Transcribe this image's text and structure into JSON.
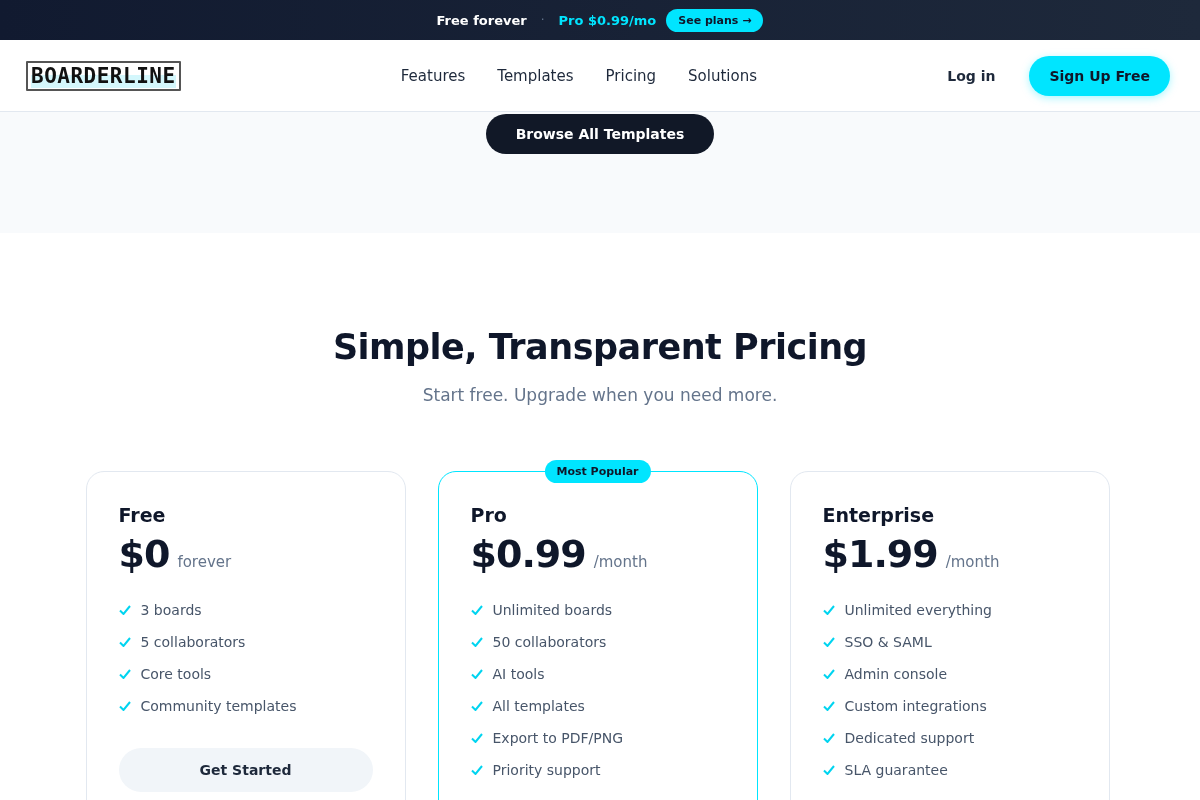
{
  "promo_bar": {
    "text": "Free forever",
    "separator": "·",
    "highlight": "Pro $0.99/mo",
    "button": "See plans →"
  },
  "header": {
    "logo": "BOARDERLINE",
    "nav": [
      {
        "label": "Features"
      },
      {
        "label": "Templates"
      },
      {
        "label": "Pricing"
      },
      {
        "label": "Solutions"
      }
    ],
    "login": "Log in",
    "signup": "Sign Up Free"
  },
  "templates_section": {
    "button": "Browse All Templates"
  },
  "pricing": {
    "title": "Simple, Transparent Pricing",
    "subtitle": "Start free. Upgrade when you need more.",
    "plans": [
      {
        "name": "Free",
        "price": "$0",
        "period": "forever",
        "featured": false,
        "features": [
          "3 boards",
          "5 collaborators",
          "Core tools",
          "Community templates"
        ],
        "button": "Get Started"
      },
      {
        "name": "Pro",
        "price": "$0.99",
        "period": "/month",
        "featured": true,
        "badge": "Most Popular",
        "features": [
          "Unlimited boards",
          "50 collaborators",
          "AI tools",
          "All templates",
          "Export to PDF/PNG",
          "Priority support"
        ]
      },
      {
        "name": "Enterprise",
        "price": "$1.99",
        "period": "/month",
        "featured": false,
        "features": [
          "Unlimited everything",
          "SSO & SAML",
          "Admin console",
          "Custom integrations",
          "Dedicated support",
          "SLA guarantee"
        ]
      }
    ]
  }
}
